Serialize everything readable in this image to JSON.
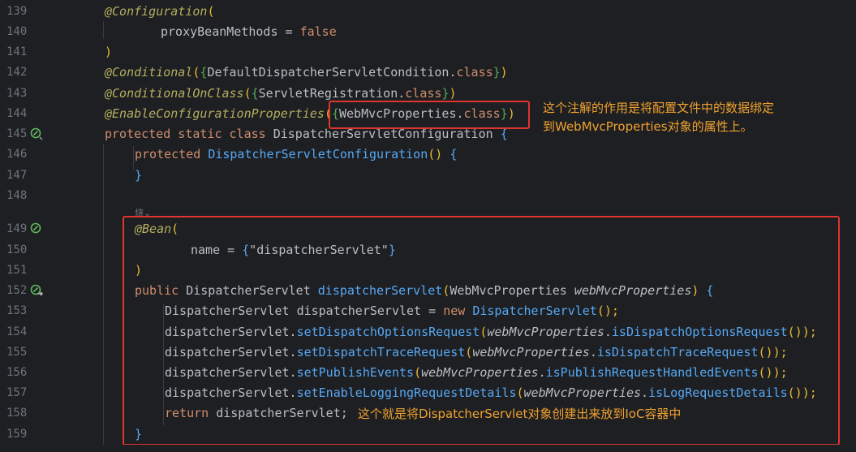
{
  "editor": {
    "line_numbers": [
      "139",
      "140",
      "141",
      "142",
      "143",
      "144",
      "145",
      "146",
      "147",
      "148",
      "149",
      "150",
      "151",
      "152",
      "153",
      "154",
      "155",
      "156",
      "157",
      "158",
      "159"
    ],
    "code": {
      "l139": {
        "ann": "@Configuration",
        "p1": "("
      },
      "l140": {
        "fld": "proxyBeanMethods",
        "eq": " = ",
        "kw": "false"
      },
      "l141": {
        "p": ")"
      },
      "l142": {
        "ann": "@Conditional",
        "p1": "(",
        "p2": "{",
        "type": "DefaultDispatcherServletCondition",
        "dot": ".",
        "kw": "class",
        "p3": "}",
        "p4": ")"
      },
      "l143": {
        "ann": "@ConditionalOnClass",
        "p1": "(",
        "p2": "{",
        "type": "ServletRegistration",
        "dot": ".",
        "kw": "class",
        "p3": "}",
        "p4": ")"
      },
      "l144": {
        "ann": "@EnableConfigurationProperties",
        "p1": "(",
        "p2": "{",
        "type": "WebMvcProperties",
        "dot": ".",
        "kw": "class",
        "p3": "}",
        "p4": ")"
      },
      "l145": {
        "kw": "protected static class ",
        "type": "DispatcherServletConfiguration ",
        "p": "{"
      },
      "l146": {
        "kw": "protected ",
        "fn": "DispatcherServletConfiguration",
        "p1": "()",
        "p2": " {"
      },
      "l147": {
        "p": "}"
      },
      "l149": {
        "ann": "@Bean",
        "p1": "("
      },
      "l150": {
        "fld": "name",
        "eq": " = ",
        "p1": "{",
        "str": "\"dispatcherServlet\"",
        "p2": "}"
      },
      "l151": {
        "p": ")"
      },
      "l152": {
        "kw": "public ",
        "type": "DispatcherServlet ",
        "fn": "dispatcherServlet",
        "p1": "(",
        "ptype": "WebMvcProperties ",
        "pname": "webMvcProperties",
        "p2": ")",
        "p3": " {"
      },
      "l153": {
        "type": "DispatcherServlet ",
        "var": "dispatcherServlet = ",
        "kw": "new ",
        "fn": "DispatcherServlet",
        "p": "();"
      },
      "l154": {
        "var": "dispatcherServlet.",
        "fn": "setDispatchOptionsRequest",
        "p1": "(",
        "obj": "webMvcProperties",
        "dot": ".",
        "fn2": "isDispatchOptionsRequest",
        "p2": "());"
      },
      "l155": {
        "var": "dispatcherServlet.",
        "fn": "setDispatchTraceRequest",
        "p1": "(",
        "obj": "webMvcProperties",
        "dot": ".",
        "fn2": "isDispatchTraceRequest",
        "p2": "());"
      },
      "l156": {
        "var": "dispatcherServlet.",
        "fn": "setPublishEvents",
        "p1": "(",
        "obj": "webMvcProperties",
        "dot": ".",
        "fn2": "isPublishRequestHandledEvents",
        "p2": "());"
      },
      "l157": {
        "var": "dispatcherServlet.",
        "fn": "setEnableLoggingRequestDetails",
        "p1": "(",
        "obj": "webMvcProperties",
        "dot": ".",
        "fn2": "isLogRequestDetails",
        "p2": "());"
      },
      "l158": {
        "kw": "return ",
        "var": "dispatcherServlet;"
      },
      "l159": {
        "p": "}"
      }
    },
    "gutter_icons": [
      "bean-icon",
      "bean-icon",
      "bean-navigate-icon"
    ],
    "inlay_hint": "烧⌄"
  },
  "annotations": {
    "note_top_line1": "这个注解的作用是将配置文件中的数据绑定",
    "note_top_line2": "到WebMvcProperties对象的属性上。",
    "note_bottom": "这个就是将DispatcherServlet对象创建出来放到IoC容器中"
  },
  "colors": {
    "background": "#1e1f22",
    "annotation": "#b3ae60",
    "keyword": "#cf8e6d",
    "function": "#56a8f5",
    "string": "#6aab73",
    "field": "#c77dbb",
    "highlight_box": "#e0342f",
    "note_text": "#f0a22e"
  }
}
